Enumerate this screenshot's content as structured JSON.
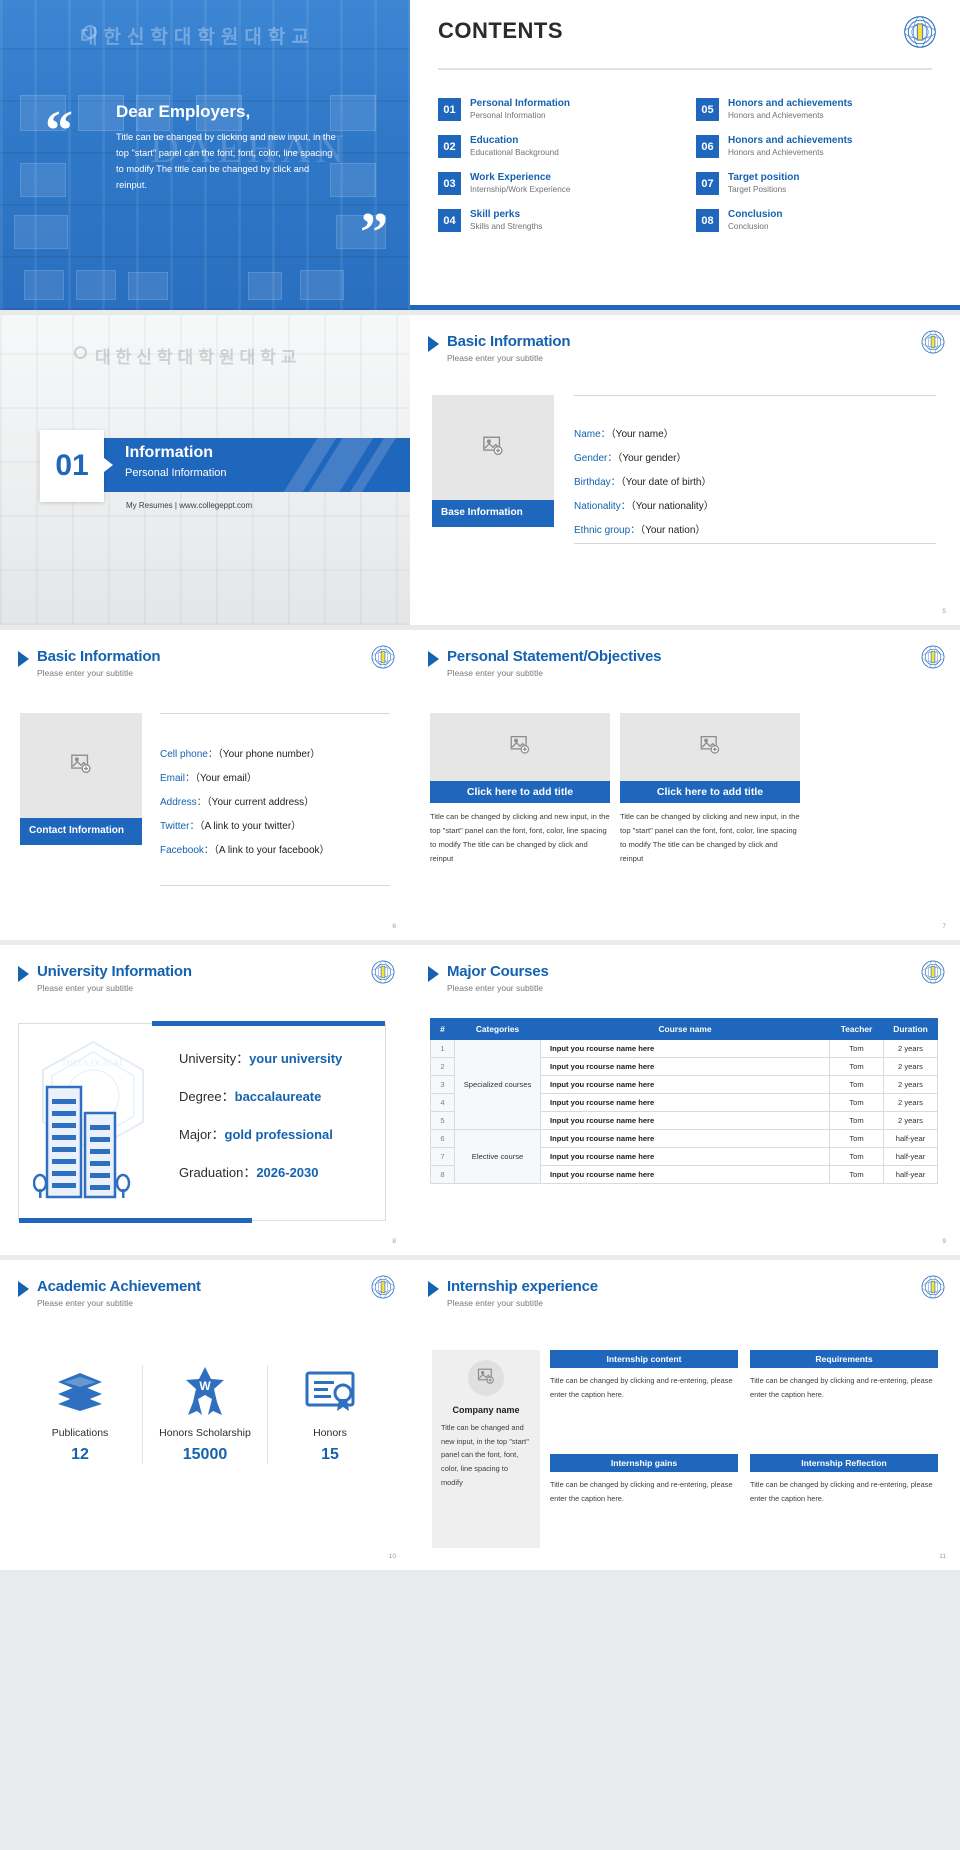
{
  "cover": {
    "korean_title": "대한신학대학원대학교",
    "watermark": "DAEHAN",
    "heading": "Dear Employers,",
    "body": "Title can be changed by clicking and new input, in the top \"start\" panel can the font, font, color, line spacing to modify The title can be changed by click and reinput.",
    "quote_open": "“",
    "quote_close": "”"
  },
  "contents": {
    "title": "CONTENTS",
    "items": [
      {
        "num": "01",
        "title": "Personal Information",
        "sub": "Personal Information"
      },
      {
        "num": "05",
        "title": "Honors and achievements",
        "sub": "Honors and Achievements"
      },
      {
        "num": "02",
        "title": "Education",
        "sub": "Educational Background"
      },
      {
        "num": "06",
        "title": "Honors and achievements",
        "sub": "Honors and Achievements"
      },
      {
        "num": "03",
        "title": "Work Experience",
        "sub": "Internship/Work Experience"
      },
      {
        "num": "07",
        "title": "Target position",
        "sub": "Target Positions"
      },
      {
        "num": "04",
        "title": "Skill perks",
        "sub": "Skills and Strengths"
      },
      {
        "num": "08",
        "title": "Conclusion",
        "sub": "Conclusion"
      }
    ]
  },
  "divider": {
    "korean_title": "대한신학대학원대학교",
    "number": "01",
    "title": "Information",
    "subtitle": "Personal Information",
    "footer": "My Resumes | www.collegeppt.com"
  },
  "base_info": {
    "title": "Basic Information",
    "subtitle": "Please enter your subtitle",
    "caption": "Base Information",
    "page": "5",
    "fields": [
      {
        "label": "Name：",
        "value": "（Your name）"
      },
      {
        "label": "Gender：",
        "value": "（Your gender）"
      },
      {
        "label": "Birthday：",
        "value": "（Your date of birth）"
      },
      {
        "label": "Nationality：",
        "value": "（Your nationality）"
      },
      {
        "label": "Ethnic group：",
        "value": "（Your nation）"
      }
    ]
  },
  "contact_info": {
    "title": "Basic Information",
    "subtitle": "Please enter your subtitle",
    "caption": "Contact Information",
    "page": "6",
    "fields": [
      {
        "label": "Cell phone：",
        "value": "（Your phone number）"
      },
      {
        "label": "Email：",
        "value": "（Your email）"
      },
      {
        "label": "Address：",
        "value": "（Your current address）"
      },
      {
        "label": "Twitter：",
        "value": "（A link to your twitter）"
      },
      {
        "label": "Facebook：",
        "value": "（A link to your facebook）"
      }
    ]
  },
  "statement": {
    "title": "Personal Statement/Objectives",
    "subtitle": "Please enter your subtitle",
    "page": "7",
    "cards": [
      {
        "button": "Click here to add title",
        "text": "Title can be changed by clicking and new input, in the top \"start\" panel can the font, font, color, line spacing to modify The title can be changed by click and reinput"
      },
      {
        "button": "Click here to add title",
        "text": "Title can be changed by clicking and new input, in the top \"start\" panel can the font, font, color, line spacing to modify The title can be changed by click and reinput"
      }
    ]
  },
  "university": {
    "title": "University Information",
    "subtitle": "Please enter your subtitle",
    "page": "8",
    "rows": [
      {
        "label": "University：",
        "value": "your university"
      },
      {
        "label": "Degree：",
        "value": "baccalaureate"
      },
      {
        "label": "Major：",
        "value": "gold professional"
      },
      {
        "label": "Graduation：",
        "value": "2026-2030"
      }
    ]
  },
  "courses": {
    "title": "Major Courses",
    "subtitle": "Please enter your subtitle",
    "page": "9",
    "headers": [
      "#",
      "Categories",
      "Course name",
      "Teacher",
      "Duration"
    ],
    "rows": [
      {
        "idx": "1",
        "category": "",
        "name": "Input you rcourse name here",
        "teacher": "Tom",
        "duration": "2 years"
      },
      {
        "idx": "2",
        "category": "",
        "name": "Input you rcourse name here",
        "teacher": "Tom",
        "duration": "2 years"
      },
      {
        "idx": "3",
        "category": "Specialized courses",
        "name": "Input you rcourse name here",
        "teacher": "Tom",
        "duration": "2 years"
      },
      {
        "idx": "4",
        "category": "",
        "name": "Input you rcourse name here",
        "teacher": "Tom",
        "duration": "2 years"
      },
      {
        "idx": "5",
        "category": "",
        "name": "Input you rcourse name here",
        "teacher": "Tom",
        "duration": "2 years"
      },
      {
        "idx": "6",
        "category": "",
        "name": "Input you rcourse name here",
        "teacher": "Tom",
        "duration": "half-year"
      },
      {
        "idx": "7",
        "category": "Elective course",
        "name": "Input you rcourse name here",
        "teacher": "Tom",
        "duration": "half-year"
      },
      {
        "idx": "8",
        "category": "",
        "name": "Input you rcourse name here",
        "teacher": "Tom",
        "duration": "half-year"
      }
    ]
  },
  "achievement": {
    "title": "Academic Achievement",
    "subtitle": "Please enter your subtitle",
    "page": "10",
    "items": [
      {
        "icon": "books-icon",
        "label": "Publications",
        "value": "12"
      },
      {
        "icon": "award-ribbon-icon",
        "label": "Honors Scholarship",
        "value": "15000"
      },
      {
        "icon": "certificate-icon",
        "label": "Honors",
        "value": "15"
      }
    ]
  },
  "internship": {
    "title": "Internship experience",
    "subtitle": "Please enter your subtitle",
    "page": "11",
    "company": "Company name",
    "company_text": "Title can be changed and new input, in the top \"start\" panel can the font, font, color, line spacing to modify",
    "panels": [
      {
        "header": "Internship content",
        "text": "Title can be changed by clicking and re-entering, please enter the caption here."
      },
      {
        "header": "Requirements",
        "text": "Title can be changed by clicking and re-entering, please enter the caption here."
      },
      {
        "header": "Internship gains",
        "text": "Title can be changed by clicking and re-entering, please enter the caption here."
      },
      {
        "header": "Internship Reflection",
        "text": "Title can be changed by clicking and re-entering, please enter the caption here."
      }
    ]
  },
  "colors": {
    "brand": "#1f66bd",
    "title": "#1562b0",
    "cover": "#2f7ed0"
  }
}
